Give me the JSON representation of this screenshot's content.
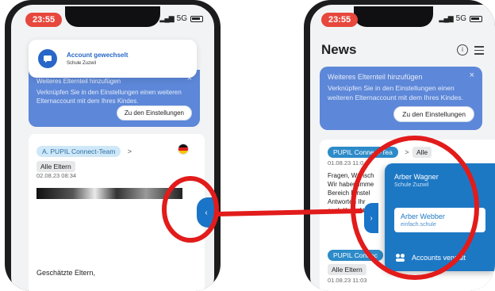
{
  "left": {
    "time": "23:55",
    "network": "5G",
    "toast": {
      "title": "Account gewechselt",
      "subtitle": "Schule Zuzwil"
    },
    "banner": {
      "title": "Weiteres Elternteil hinzufügen",
      "text": "Verknüpfen Sie in den Einstellungen einen weiteren Elternaccount mit dem Ihres Kindes.",
      "button": "Zu den Einstellungen",
      "close": "×"
    },
    "post": {
      "sender": "A. PUPIL Connect-Team",
      "chevron": ">",
      "audience": "Alle Eltern",
      "date": "02.08.23 08:34",
      "greeting": "Geschätzte Eltern,"
    },
    "handle": "‹"
  },
  "right": {
    "time": "23:55",
    "network": "5G",
    "title": "News",
    "info": "i",
    "banner": {
      "title": "Weiteres Elternteil hinzufügen",
      "text": "Verknüpfen Sie in den Einstellungen einen weiteren Elternaccount mit dem Ihres Kindes.",
      "button": "Zu den Einstellungen",
      "close": "×"
    },
    "post1": {
      "sender": "PUPIL Connect-Tea",
      "chevron": ">",
      "audience": "Alle",
      "date": "01.08.23 11:0",
      "body": "Fragen, Wunsch Wir haben imme Bereich Einstel Antworten Ihr auch Kontakt"
    },
    "post2": {
      "sender": "PUPIL Connec",
      "audience": "Alle Eltern",
      "date": "01.08.23 11:03"
    },
    "handle": "›",
    "accounts": [
      {
        "name": "Arber Wagner",
        "school": "Schule Zuzwil"
      },
      {
        "name": "Arber Webber",
        "school": "einfach.schule"
      }
    ],
    "manage": "Accounts verwalt"
  },
  "colors": {
    "accent": "#1d78c4",
    "banner": "#5d87d8",
    "annotation": "#e21b1b",
    "time_pill": "#e7473c"
  }
}
